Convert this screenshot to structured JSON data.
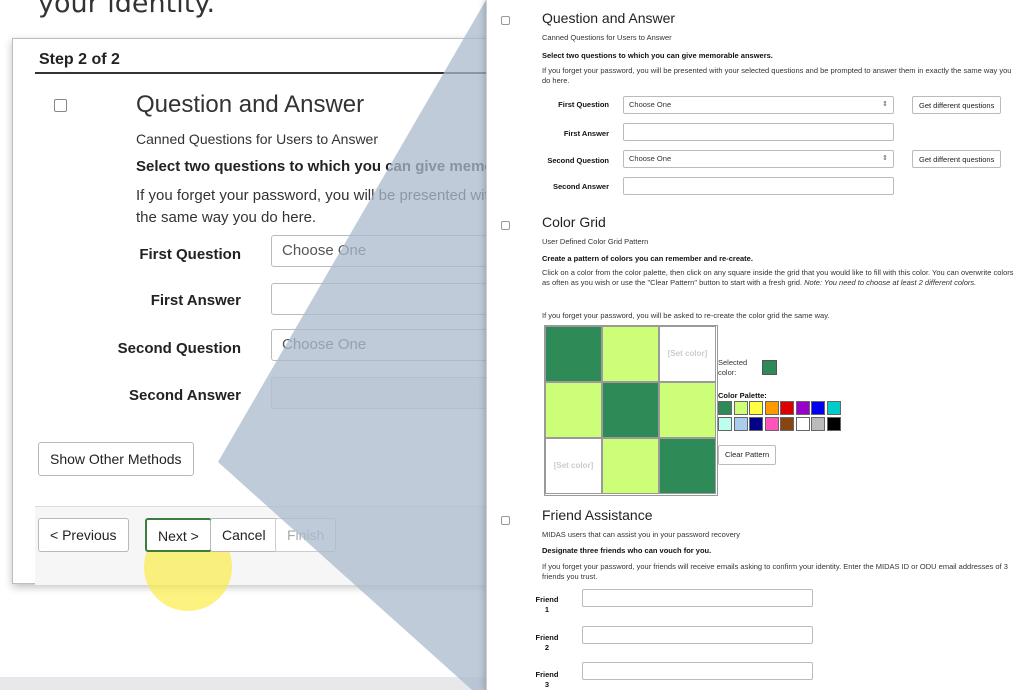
{
  "caption": "your identity.",
  "colors": {
    "dark_green": "#2e8b57",
    "light_green": "#ccff77",
    "highlight": "#f5e93a",
    "wedge": "#a9b9cc"
  },
  "big": {
    "step": "Step 2 of 2",
    "title": "Question and Answer",
    "subtitle": "Canned Questions for Users to Answer",
    "bold": "Select two questions to which you can give memorabl",
    "para_line1": "If you forget your password, you will be presented with yo",
    "para_line2": "the same way you do here.",
    "first_question_label": "First Question",
    "first_question_value": "Choose One",
    "first_answer_label": "First Answer",
    "second_question_label": "Second Question",
    "second_question_value": "Choose One",
    "second_answer_label": "Second Answer",
    "show_other": "Show Other Methods",
    "previous": "< Previous",
    "next": "Next >",
    "cancel": "Cancel",
    "finish": "Finish"
  },
  "qa": {
    "title": "Question and Answer",
    "subtitle": "Canned Questions for Users to Answer",
    "bold": "Select two questions to which you can give memorable answers.",
    "para": "If you forget your password, you will be presented with your selected questions and be prompted to answer them in exactly the same way you do here.",
    "first_question_label": "First Question",
    "first_question_value": "Choose One",
    "first_answer_label": "First Answer",
    "second_question_label": "Second Question",
    "second_question_value": "Choose One",
    "second_answer_label": "Second Answer",
    "get_different": "Get different questions"
  },
  "color_grid": {
    "title": "Color Grid",
    "subtitle": "User Defined Color Grid Pattern",
    "bold": "Create a pattern of colors you can remember and re-create.",
    "para": "Click on a color from the color palette, then click on any square inside the grid that you would like to fill with this color. You can overwrite colors as often as you wish or use the \"Clear Pattern\" button to start with a fresh grid.",
    "note": "Note: You need to choose at least 2 different colors.",
    "para2": "If you forget your password, you will be asked to re-create the color grid the same way.",
    "set_color": "[Set color]",
    "selected_label": "Selected color:",
    "palette_label": "Color Palette:",
    "clear": "Clear Pattern",
    "cells": [
      "dark",
      "light",
      "empty",
      "light",
      "dark",
      "light",
      "empty",
      "light",
      "dark"
    ],
    "palette": [
      "#2e8b57",
      "#ccff77",
      "#ffff44",
      "#ff9900",
      "#dd0000",
      "#9900cc",
      "#0000ee",
      "#00cccc",
      "#bbffee",
      "#aaccee",
      "#000088",
      "#ff55bb",
      "#884411",
      "#ffffff",
      "#bbbbbb",
      "#000000"
    ]
  },
  "friend": {
    "title": "Friend Assistance",
    "subtitle": "MIDAS users that can assist you in your password recovery",
    "bold": "Designate three friends who can vouch for you.",
    "para": "If you forget your password, your friends will receive emails asking to confirm your identity. Enter the MIDAS ID or ODU email addresses of 3 friends you trust.",
    "friend_label": "Friend",
    "friend_numbers": [
      "1",
      "2",
      "3"
    ]
  }
}
